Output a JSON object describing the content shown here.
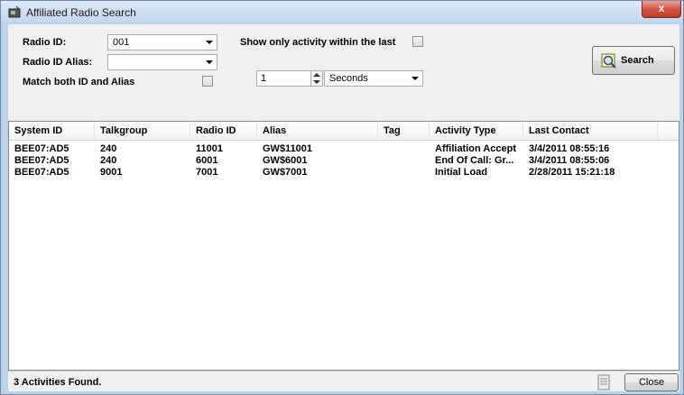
{
  "window": {
    "title": "Affiliated Radio Search",
    "close_glyph": "x"
  },
  "form": {
    "radio_id_label": "Radio ID:",
    "radio_id_value": "001",
    "radio_id_alias_label": "Radio ID Alias:",
    "radio_id_alias_value": "",
    "match_both_label": "Match both ID and Alias",
    "match_both_checked": false,
    "show_only_label": "Show only activity within the last",
    "show_only_checked": false,
    "interval_value": "1",
    "interval_unit": "Seconds",
    "search_label": "Search"
  },
  "table": {
    "columns": [
      "System ID",
      "Talkgroup",
      "Radio ID",
      "Alias",
      "Tag",
      "Activity Type",
      "Last Contact"
    ],
    "rows": [
      [
        "BEE07:AD5",
        "240",
        "11001",
        "GW$11001",
        "",
        "Affiliation Accept",
        "3/4/2011 08:55:16"
      ],
      [
        "BEE07:AD5",
        "240",
        "6001",
        "GW$6001",
        "",
        "End Of Call: Gr...",
        "3/4/2011 08:55:06"
      ],
      [
        "BEE07:AD5",
        "9001",
        "7001",
        "GW$7001",
        "",
        "Initial Load",
        "2/28/2011 15:21:18"
      ]
    ]
  },
  "status": {
    "text": "3 Activities Found.",
    "close_label": "Close"
  },
  "icons": {
    "window": "radio-icon",
    "search": "magnifier-icon",
    "status": "document-icon"
  }
}
